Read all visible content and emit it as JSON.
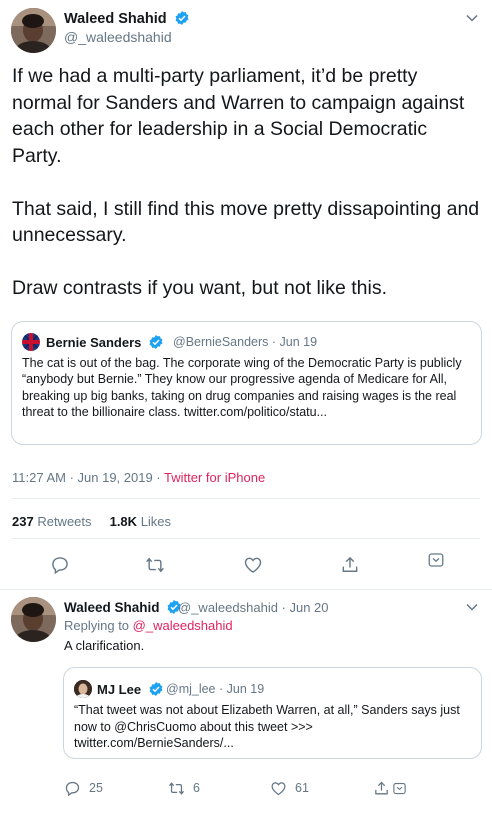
{
  "main_tweet": {
    "author_name": "Waleed Shahid",
    "author_handle": "@_waleedshahid",
    "text": "If we had a multi-party parliament, it’d be pretty normal for Sanders and Warren to campaign against each other for leadership in a Social Democratic Party.\n\nThat said, I still find this move pretty dissapointing and unnecessary.\n\nDraw contrasts if you want, but not like this.",
    "quoted": {
      "author_name": "Bernie Sanders",
      "meta": "@BernieSanders · Jun 19",
      "text": "The cat is out of the bag. The corporate wing of the Democratic Party is publicly “anybody but Bernie.” They know our progressive agenda of Medicare for All, breaking up big banks, taking on drug companies and raising wages is the real threat to the billionaire class. twitter.com/politico/statu..."
    },
    "time": "11:27 AM · Jun 19, 2019 ·",
    "source": "Twitter for iPhone",
    "retweets_count": "237",
    "retweets_label": "Retweets",
    "likes_count": "1.8K",
    "likes_label": "Likes"
  },
  "reply_tweet": {
    "author_name": "Waleed Shahid",
    "meta": "@_waleedshahid · Jun 20",
    "replying_prefix": "Replying to",
    "replying_handle": "@_waleedshahid",
    "text": "A clarification.",
    "quoted": {
      "author_name": "MJ Lee",
      "meta": "@mj_lee · Jun 19",
      "text": "“That tweet was not about Elizabeth Warren, at all,” Sanders says just now to @ChrisCuomo about this tweet >>> twitter.com/BernieSanders/..."
    },
    "reply_count": "25",
    "retweet_count": "6",
    "like_count": "61"
  },
  "colors": {
    "accent": "#e0245e",
    "secondary_text": "#657786",
    "border": "#ccd6dd",
    "verified": "#1da1f2"
  },
  "icons": [
    "verified-badge-icon",
    "chevron-down-icon",
    "reply-icon",
    "retweet-icon",
    "like-icon",
    "share-icon",
    "bookmark-icon"
  ]
}
